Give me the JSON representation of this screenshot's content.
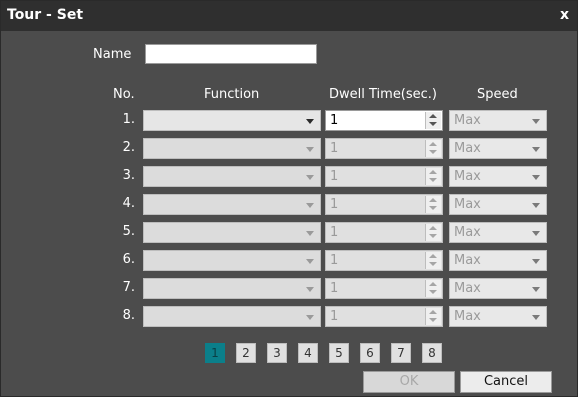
{
  "dialog": {
    "title": "Tour - Set",
    "close": "x"
  },
  "name_field": {
    "label": "Name",
    "value": ""
  },
  "columns": {
    "no": "No.",
    "function": "Function",
    "dwell": "Dwell Time(sec.)",
    "speed": "Speed"
  },
  "rows": [
    {
      "no": "1.",
      "dwell": "1",
      "speed": "Max",
      "enabled": true
    },
    {
      "no": "2.",
      "dwell": "1",
      "speed": "Max",
      "enabled": false
    },
    {
      "no": "3.",
      "dwell": "1",
      "speed": "Max",
      "enabled": false
    },
    {
      "no": "4.",
      "dwell": "1",
      "speed": "Max",
      "enabled": false
    },
    {
      "no": "5.",
      "dwell": "1",
      "speed": "Max",
      "enabled": false
    },
    {
      "no": "6.",
      "dwell": "1",
      "speed": "Max",
      "enabled": false
    },
    {
      "no": "7.",
      "dwell": "1",
      "speed": "Max",
      "enabled": false
    },
    {
      "no": "8.",
      "dwell": "1",
      "speed": "Max",
      "enabled": false
    }
  ],
  "pagination": {
    "pages": [
      "1",
      "2",
      "3",
      "4",
      "5",
      "6",
      "7",
      "8"
    ],
    "active": "1"
  },
  "buttons": {
    "ok": "OK",
    "cancel": "Cancel"
  }
}
